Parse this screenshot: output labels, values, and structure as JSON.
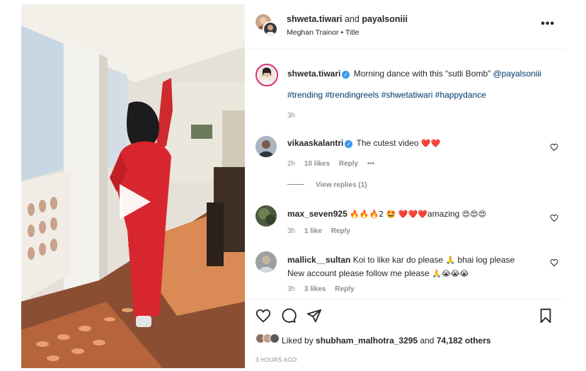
{
  "header": {
    "user1": "shweta.tiwari",
    "and": "and",
    "user2": "payalsoniii",
    "audio": "Meghan Trainor • Title",
    "more_icon": "more-horizontal-icon"
  },
  "caption": {
    "username": "shweta.tiwari",
    "text": "Morning dance with this “sutli Bomb”",
    "mention": "@payalsoniii",
    "hashtags": "#trending #trendingreels #shwetatiwari #happydance",
    "time": "3h"
  },
  "comments": [
    {
      "username": "vikaaskalantri",
      "verified": true,
      "text": "The cutest video",
      "emoji": "❤️❤️",
      "time": "2h",
      "likes": "10 likes",
      "reply": "Reply",
      "options": "•••",
      "view_replies": "View replies (1)"
    },
    {
      "username": "max_seven925",
      "text_a": "🔥🔥🔥2 🤩 ❤️❤️❤️",
      "text_b": "amazing",
      "text_c": "😍😍😍",
      "time": "3h",
      "likes": "1 like",
      "reply": "Reply"
    },
    {
      "username": "mallick__sultan",
      "text_a": "Koi to like kar do please",
      "text_b": "🙏",
      "text_c": "bhai log please",
      "text_d": "New account please follow me please",
      "text_e": "🙏😭😭😭",
      "time": "3h",
      "likes": "3 likes",
      "reply": "Reply"
    }
  ],
  "actions": {
    "like_icon": "heart-icon",
    "comment_icon": "comment-icon",
    "share_icon": "send-icon",
    "save_icon": "bookmark-icon"
  },
  "likes": {
    "prefix": "Liked by",
    "user": "shubham_malhotra_3295",
    "and": "and",
    "others": "74,182 others"
  },
  "timestamp": "3 HOURS AGO",
  "colors": {
    "accent_link": "#00376b",
    "verified": "#3897f0",
    "muted": "#8e8e8e",
    "dress": "#d7262d"
  }
}
